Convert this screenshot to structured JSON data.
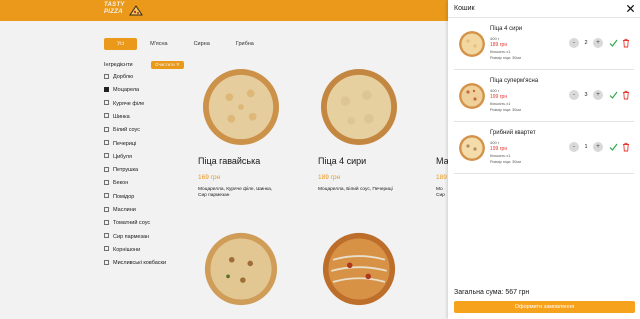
{
  "header": {
    "logo_text": "TASTY PIZZA",
    "brand_color": "#f7a21c"
  },
  "tabs": [
    {
      "label": "Усі",
      "active": true
    },
    {
      "label": "М'ясна",
      "active": false
    },
    {
      "label": "Сирна",
      "active": false
    },
    {
      "label": "Грибна",
      "active": false
    }
  ],
  "filters": {
    "title": "Інгрeдієнти",
    "clear_label": "Очистити ✕",
    "items": [
      {
        "label": "Дорблю",
        "checked": false
      },
      {
        "label": "Моцарела",
        "checked": true
      },
      {
        "label": "Куряче філе",
        "checked": false
      },
      {
        "label": "Шинка",
        "checked": false
      },
      {
        "label": "Білий соус",
        "checked": false
      },
      {
        "label": "Печериці",
        "checked": false
      },
      {
        "label": "Цибуля",
        "checked": false
      },
      {
        "label": "Петрушка",
        "checked": false
      },
      {
        "label": "Бекон",
        "checked": false
      },
      {
        "label": "Помідор",
        "checked": false
      },
      {
        "label": "Маслини",
        "checked": false
      },
      {
        "label": "Томатний соус",
        "checked": false
      },
      {
        "label": "Сир пармезан",
        "checked": false
      },
      {
        "label": "Корнішони",
        "checked": false
      },
      {
        "label": "Мисливські ковбаски",
        "checked": false
      }
    ]
  },
  "products": [
    {
      "name": "Піца гавайська",
      "price": "169 грн",
      "desc_line1": "Моцарелла, Куряче філе, Шинка,",
      "desc_line2": "Сир пармезан"
    },
    {
      "name": "Піца 4 сири",
      "price": "189 грн",
      "desc_line1": "Моцарелла, Білий соус, Печериці",
      "desc_line2": ""
    },
    {
      "name": "Ма",
      "price": "189",
      "desc_line1": "Мо",
      "desc_line2": "Сир"
    }
  ],
  "cart": {
    "title": "Кошик",
    "items": [
      {
        "name": "Піца 4 сири",
        "weight": "400 г",
        "price": "189 грн",
        "qty_text": "Кількість x1",
        "size": "Розмір піци: 30см",
        "quantity": "2"
      },
      {
        "name": "Піца суперм'ясна",
        "weight": "400 г",
        "price": "199 грн",
        "qty_text": "Кількість x1",
        "size": "Розмір піци: 30см",
        "quantity": "3"
      },
      {
        "name": "Грибний квартет",
        "weight": "400 г",
        "price": "199 грн",
        "qty_text": "Кількість x1",
        "size": "Розмір піци: 30см",
        "quantity": "1"
      }
    ],
    "minus": "-",
    "plus": "+",
    "total": "Загальна сума: 567 грн",
    "order_label": "Оформити замовлення"
  },
  "colors": {
    "accent": "#f7a21c",
    "price_red": "#e8352d",
    "confirm_green": "#2fa84f",
    "delete_red": "#e8352d"
  }
}
